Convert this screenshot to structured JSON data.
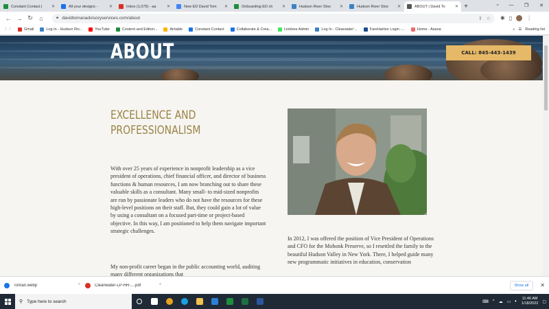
{
  "tabs": [
    {
      "title": "Constant Contact |",
      "color": "#1e8e3e",
      "active": false
    },
    {
      "title": "All your designs -",
      "color": "#1a73e8",
      "active": false
    },
    {
      "title": "Inbox (1,075) - aa",
      "color": "#d93025",
      "active": false
    },
    {
      "title": "New ED David Tom",
      "color": "#4285f4",
      "active": false
    },
    {
      "title": "Onboarding ED ch",
      "color": "#1e8e3e",
      "active": false
    },
    {
      "title": "Hudson River Sloo",
      "color": "#3b82c4",
      "active": false
    },
    {
      "title": "Hudson River Sloo",
      "color": "#3b82c4",
      "active": false
    },
    {
      "title": "ABOUT | David To",
      "color": "#555555",
      "active": true
    }
  ],
  "browser": {
    "url": "davidtomanadvisoryservices.com/about",
    "reading_list": "Reading list"
  },
  "bookmarks": [
    {
      "label": "Gmail",
      "color": "#d93025"
    },
    {
      "label": "Log In - Hudson Riv...",
      "color": "#3b82c4"
    },
    {
      "label": "YouTube",
      "color": "#ff0000"
    },
    {
      "label": "Content and Editori...",
      "color": "#1e8e3e"
    },
    {
      "label": "Airtable",
      "color": "#fcb400"
    },
    {
      "label": "Constant Contact",
      "color": "#1a73e8"
    },
    {
      "label": "Collaborate & Crea...",
      "color": "#1a73e8"
    },
    {
      "label": "Linktree Admin",
      "color": "#43e660"
    },
    {
      "label": "Log In - Clearwater'...",
      "color": "#3b82c4"
    },
    {
      "label": "FareHarbor Login -...",
      "color": "#1a4d8f"
    },
    {
      "label": "Home - Asana",
      "color": "#f06a6a"
    }
  ],
  "page": {
    "hero_title": "ABOUT",
    "call_button": "CALL: 845-443-1439",
    "heading": "EXCELLENCE AND PROFESSIONALISM",
    "para1": "With over 25 years of experience in nonprofit leadership as a vice president of operations, chief financial officer, and director of business functions & human resources, I am now branching out to share these valuable skills as a consultant. Many small- to mid-sized nonprofits are run by passionate leaders who do not have the resources for these high-level positions on their staff. But, they could gain a lot of value by using a consultant on a focused part-time or project-based objective. In this way, I am positioned to help them navigate important strategic challenges.",
    "para2": "My non-profit career began in the public accounting world, auditing many different organizations that",
    "para3": "In 2012, I was offered the position of Vice President of Operations and CFO for the Mohonk Preserve, so I resettled the family to the beautiful Hudson Valley in New York. There, I helped guide many new programmatic initiatives in education, conservation"
  },
  "downloads": [
    {
      "name": "Toman.webp",
      "color": "#1a73e8"
    },
    {
      "name": "Cleanwater-LP-HR-....pdf",
      "color": "#d93025"
    }
  ],
  "download_bar": {
    "show_all": "Show all"
  },
  "taskbar": {
    "search_placeholder": "Type here to search",
    "time": "11:46 AM",
    "date": "1/18/2022",
    "apps": [
      {
        "name": "task-view",
        "color": "#ffffff"
      },
      {
        "name": "chrome",
        "color": "#e5a220"
      },
      {
        "name": "edge",
        "color": "#1ba1e2"
      },
      {
        "name": "file-explorer",
        "color": "#f2c14e"
      },
      {
        "name": "mail",
        "color": "#2f7fd6"
      },
      {
        "name": "sheets",
        "color": "#1e8e3e"
      },
      {
        "name": "excel",
        "color": "#1d6f42"
      },
      {
        "name": "word",
        "color": "#2b579a"
      }
    ]
  }
}
